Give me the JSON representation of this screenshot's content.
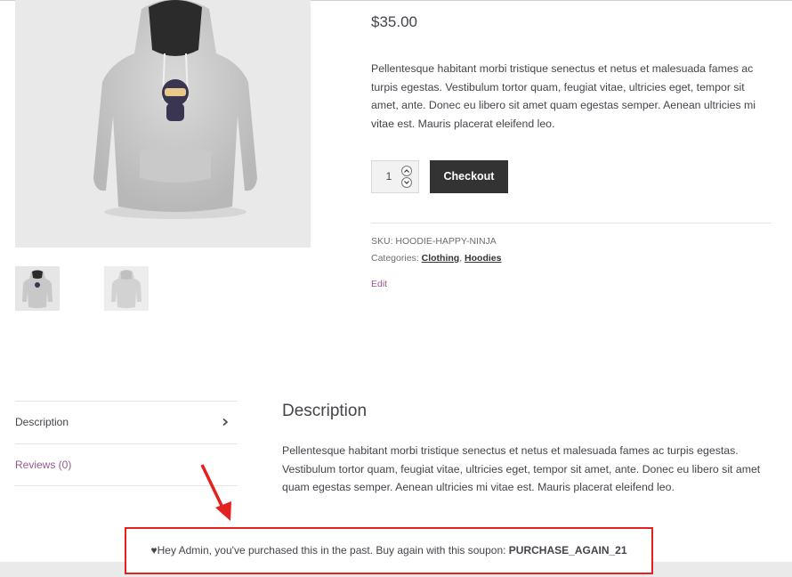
{
  "product": {
    "price": "$35.00",
    "short_description": "Pellentesque habitant morbi tristique senectus et netus et malesuada fames ac turpis egestas. Vestibulum tortor quam, feugiat vitae, ultricies eget, tempor sit amet, ante. Donec eu libero sit amet quam egestas semper. Aenean ultricies mi vitae est. Mauris placerat eleifend leo.",
    "quantity": "1",
    "checkout_label": "Checkout",
    "sku_text": "SKU: HOODIE-HAPPY-NINJA",
    "categories_label": "Categories:",
    "categories": [
      "Clothing",
      "Hoodies"
    ],
    "categories_separator": ",",
    "edit_label": "Edit"
  },
  "gallery": {
    "main_icon": "hoodie-ninja-image",
    "thumbnails": [
      "hoodie-ninja-thumb",
      "hoodie-back-thumb"
    ]
  },
  "tabs": {
    "items": [
      {
        "label": "Description"
      },
      {
        "label": "Reviews (0)"
      }
    ]
  },
  "description": {
    "heading": "Description",
    "body": "Pellentesque habitant morbi tristique senectus et netus et malesuada fames ac turpis egestas. Vestibulum tortor quam, feugiat vitae, ultricies eget, tempor sit amet, ante. Donec eu libero sit amet quam egestas semper. Aenean ultricies mi vitae est. Mauris placerat eleifend leo."
  },
  "notice": {
    "heart": "♥",
    "message": "Hey Admin, you've purchased this in the past. Buy again with this soupon: ",
    "coupon": "PURCHASE_AGAIN_21"
  },
  "colors": {
    "accent_link": "#96588a",
    "button_bg": "#333333",
    "highlight_red": "#e52020",
    "text": "#43454b"
  }
}
